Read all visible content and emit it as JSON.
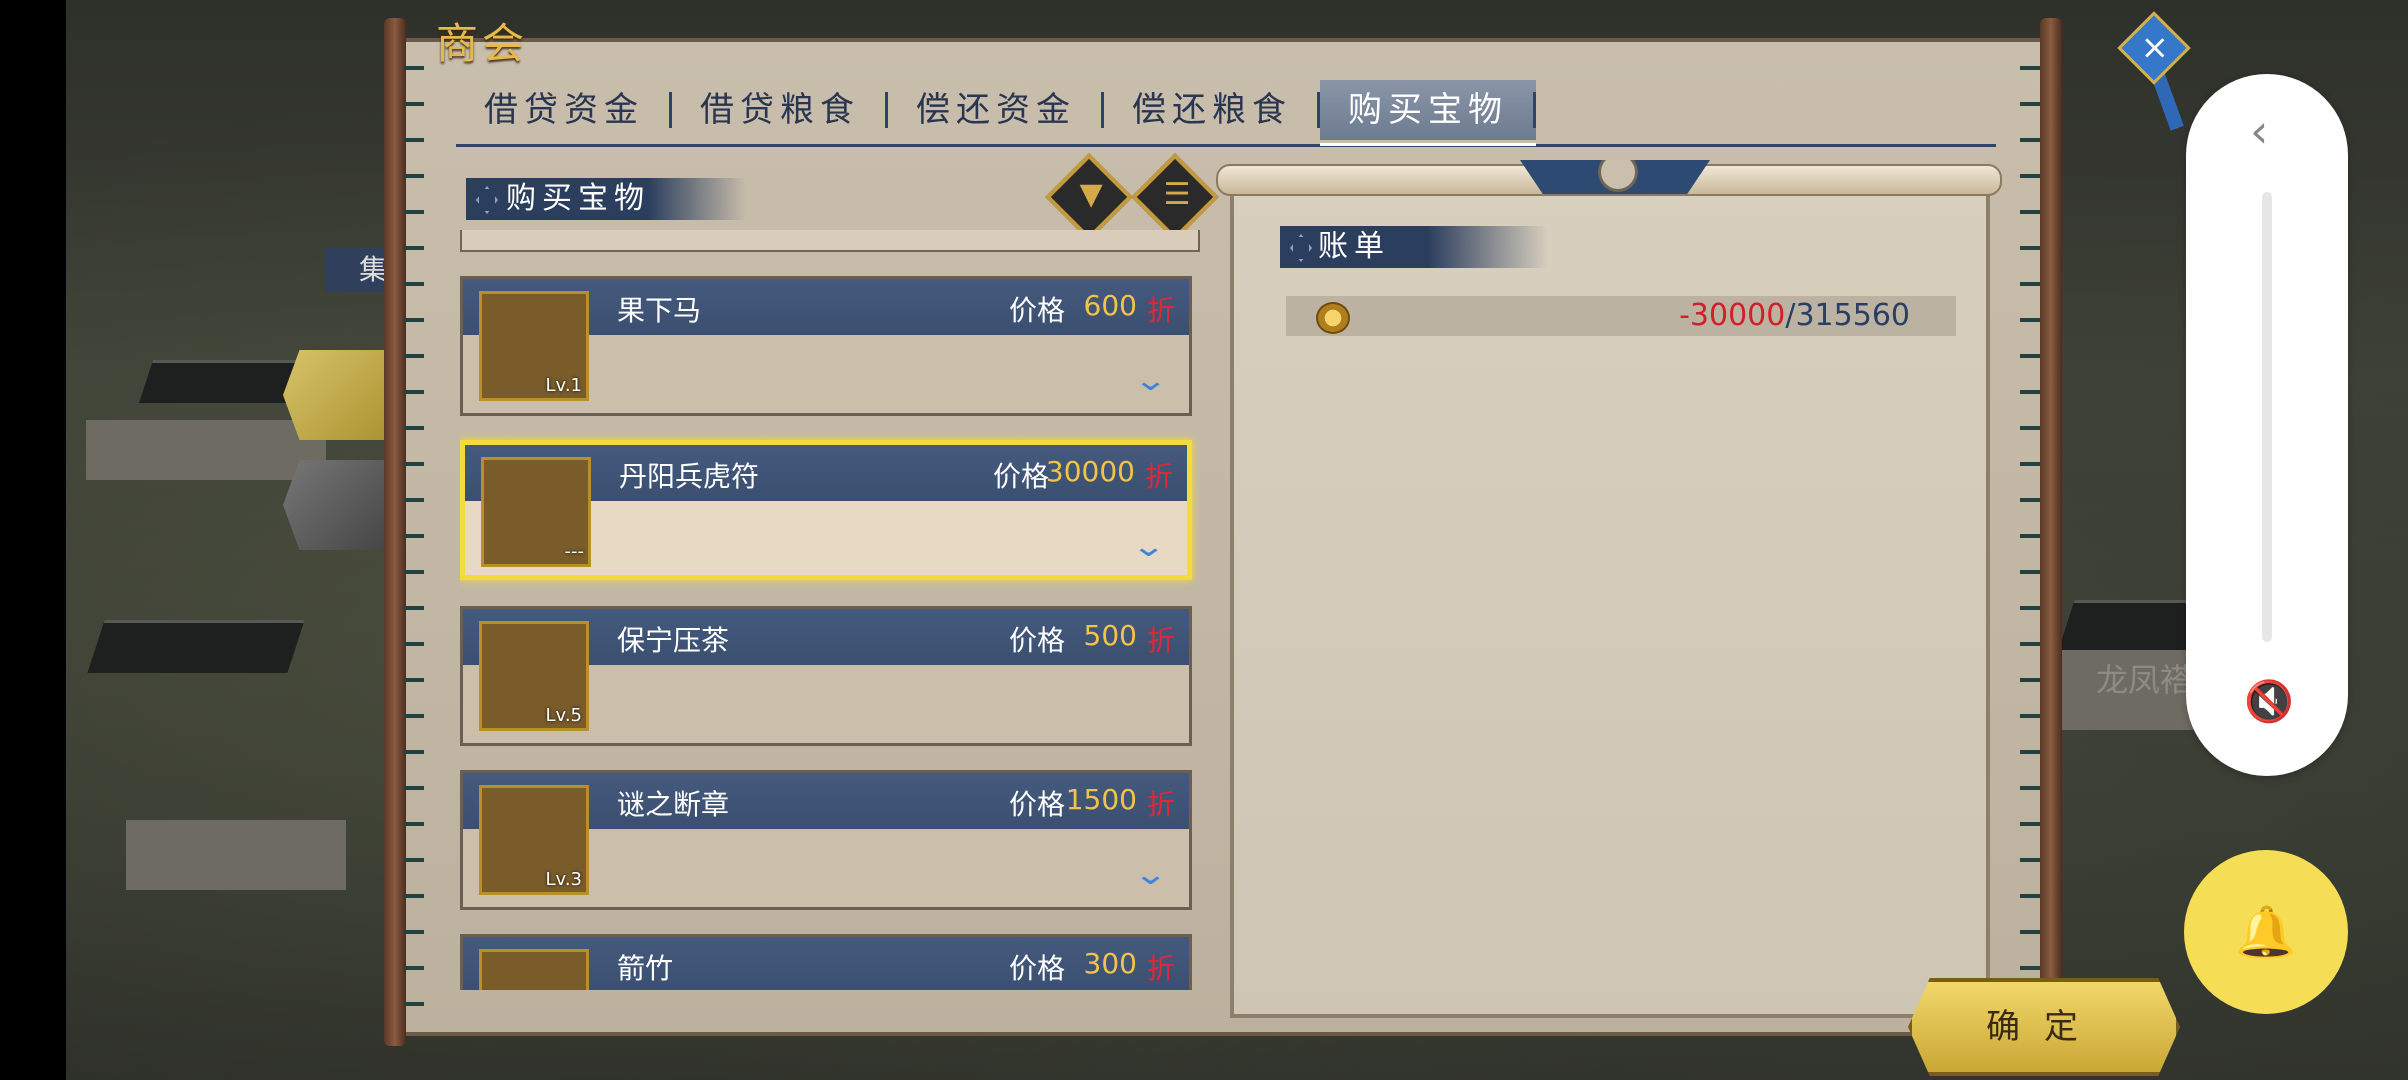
{
  "window": {
    "title": "商会"
  },
  "tabs": [
    {
      "label": "借贷资金",
      "active": false
    },
    {
      "label": "借贷粮食",
      "active": false
    },
    {
      "label": "偿还资金",
      "active": false
    },
    {
      "label": "偿还粮食",
      "active": false
    },
    {
      "label": "购买宝物",
      "active": true
    }
  ],
  "left_panel": {
    "header": "购买宝物",
    "filter_icon": "filter-icon",
    "list_icon": "list-icon"
  },
  "items": [
    {
      "name": "果下马",
      "price_label": "价格",
      "price": "600",
      "discount": "折",
      "level": "Lv.1",
      "expandable": true,
      "selected": false,
      "icon": "horse-icon"
    },
    {
      "name": "丹阳兵虎符",
      "price_label": "价格",
      "price": "30000",
      "discount": "折",
      "level": "---",
      "expandable": true,
      "selected": true,
      "icon": "tiger-tally-icon"
    },
    {
      "name": "保宁压茶",
      "price_label": "价格",
      "price": "500",
      "discount": "折",
      "level": "Lv.5",
      "expandable": false,
      "selected": false,
      "icon": "tea-jar-icon"
    },
    {
      "name": "谜之断章",
      "price_label": "价格",
      "price": "1500",
      "discount": "折",
      "level": "Lv.3",
      "expandable": true,
      "selected": false,
      "icon": "scroll-icon"
    },
    {
      "name": "箭竹",
      "price_label": "价格",
      "price": "300",
      "discount": "折",
      "level": "",
      "expandable": false,
      "selected": false,
      "icon": "bamboo-icon"
    }
  ],
  "bill": {
    "header": "账单",
    "cost": "-30000",
    "separator": "/",
    "total": "315560"
  },
  "confirm": {
    "label": "确定"
  },
  "background": {
    "side_tag": "集",
    "place_text": "龙凤褡"
  },
  "colors": {
    "accent": "#f2c34a",
    "tab_blue": "#2f4466",
    "discount_red": "#e2263a",
    "select_yellow": "#f3dc39"
  }
}
